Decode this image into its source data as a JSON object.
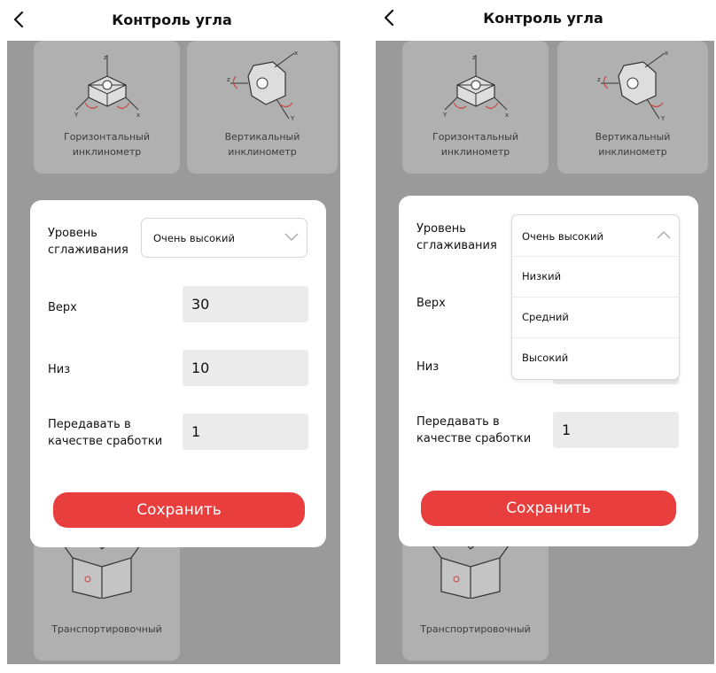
{
  "screens": [
    {
      "title": "Контроль угла",
      "tiles": {
        "horizontal": [
          "Горизонтальный",
          "инклинометр"
        ],
        "vertical": [
          "Вертикальный",
          "инклинометр"
        ],
        "transport": "Транспортировочный"
      },
      "dialog": {
        "smoothing_label": [
          "Уровень",
          "сглаживания"
        ],
        "smoothing_value": "Очень высокий",
        "top_label": "Верх",
        "top_value": "30",
        "bottom_label": "Низ",
        "bottom_value": "10",
        "transmit_label": [
          "Передавать в",
          "качестве сработки"
        ],
        "transmit_value": "1",
        "save_label": "Сохранить"
      }
    },
    {
      "title": "Контроль угла",
      "tiles": {
        "horizontal": [
          "Горизонтальный",
          "инклинометр"
        ],
        "vertical": [
          "Вертикальный",
          "инклинометр"
        ],
        "transport": "Транспортировочный"
      },
      "dialog": {
        "smoothing_label": [
          "Уровень",
          "сглаживания"
        ],
        "smoothing_value": "Очень высокий",
        "options": [
          "Низкий",
          "Средний",
          "Высокий"
        ],
        "top_label": "Верх",
        "bottom_label": "Низ",
        "transmit_label": [
          "Передавать в",
          "качестве сработки"
        ],
        "transmit_value": "1",
        "save_label": "Сохранить"
      }
    }
  ],
  "colors": {
    "accent": "#e83e3e",
    "overlay": "#9a9a9a",
    "tile": "#b0b0b0",
    "field": "#ebebeb"
  },
  "icons": [
    "chevron-left-icon",
    "chevron-down-icon",
    "chevron-up-icon",
    "inclinometer-horizontal-icon",
    "inclinometer-vertical-icon",
    "box-icon"
  ]
}
